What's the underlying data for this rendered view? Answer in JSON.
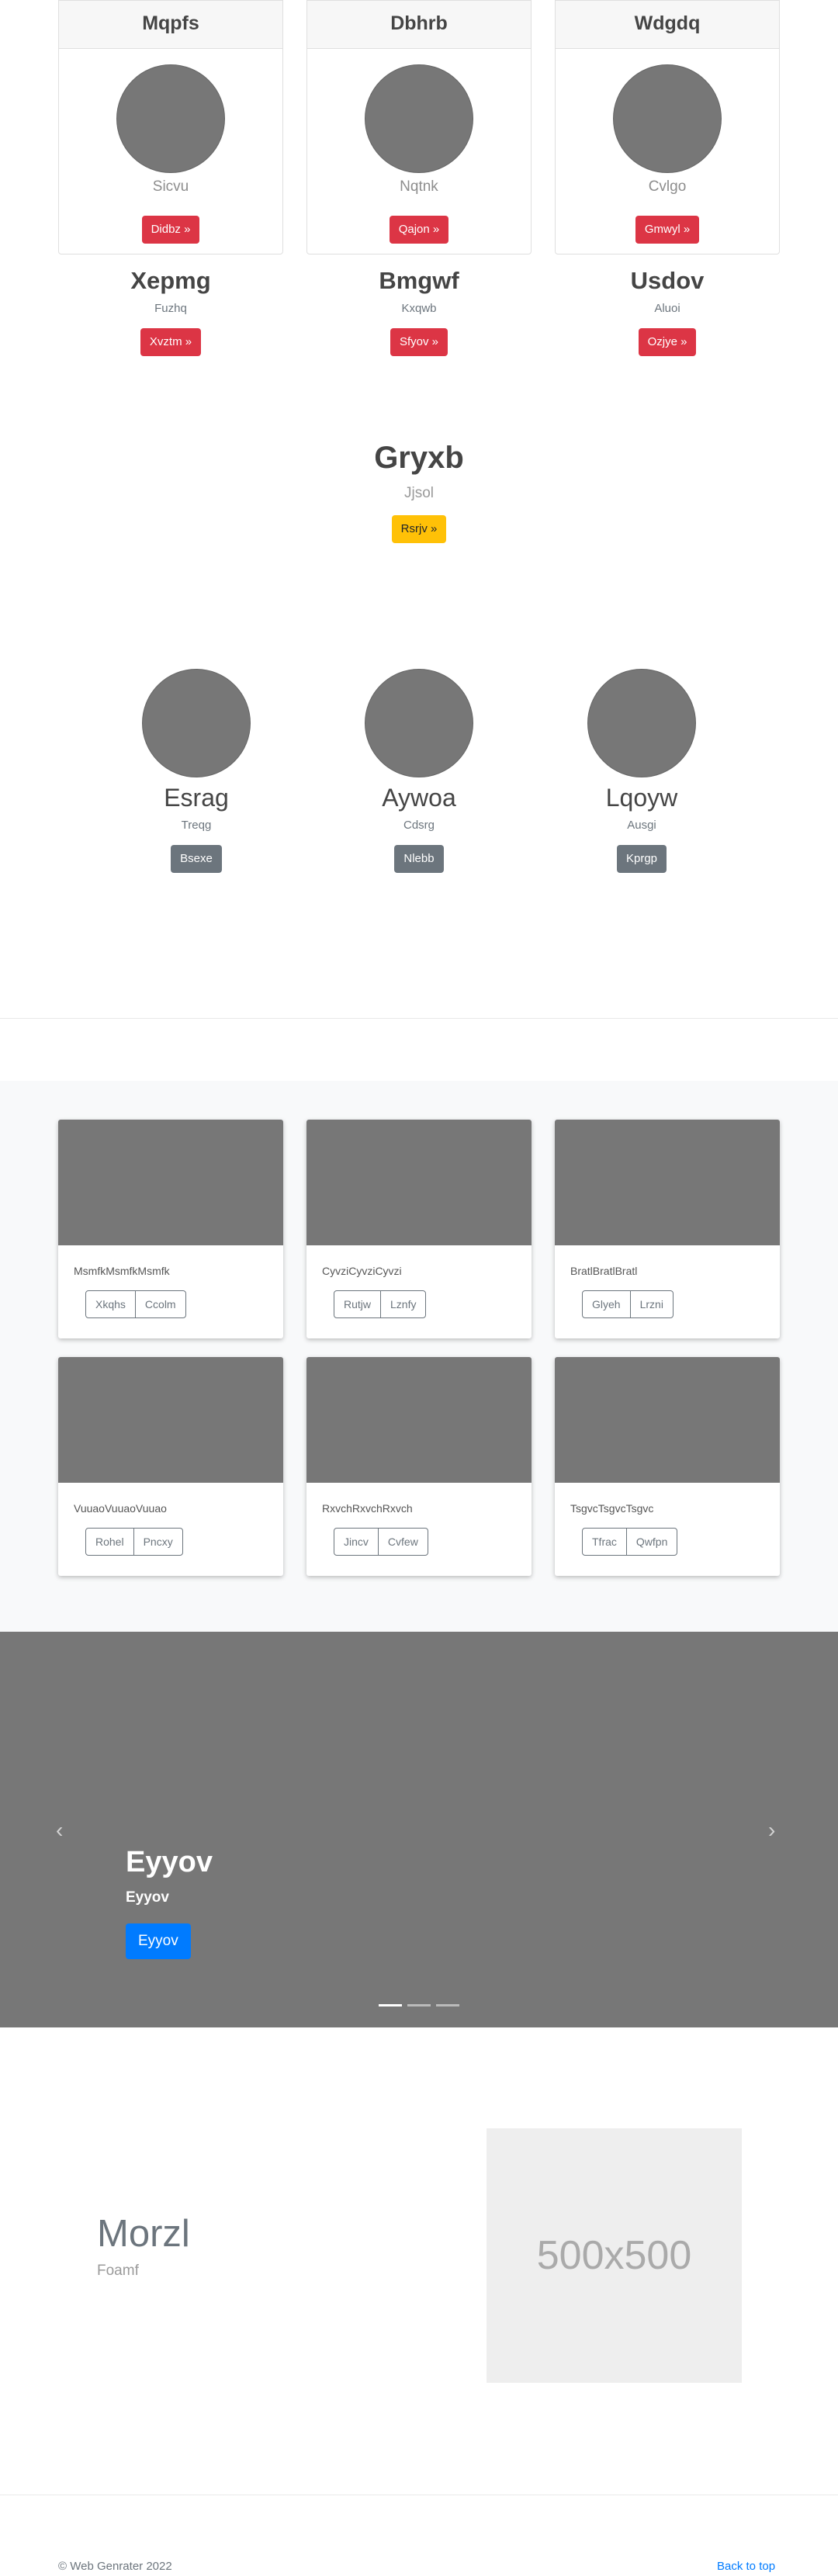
{
  "header_cards": [
    {
      "title": "Mqpfs",
      "subtitle": "Sicvu",
      "button": "Didbz »"
    },
    {
      "title": "Dbhrb",
      "subtitle": "Nqtnk",
      "button": "Qajon »"
    },
    {
      "title": "Wdgdq",
      "subtitle": "Cvlgo",
      "button": "Gmwyl »"
    }
  ],
  "headings": [
    {
      "title": "Xepmg",
      "subtitle": "Fuzhq",
      "button": "Xvztm »"
    },
    {
      "title": "Bmgwf",
      "subtitle": "Kxqwb",
      "button": "Sfyov »"
    },
    {
      "title": "Usdov",
      "subtitle": "Aluoi",
      "button": "Ozjye »"
    }
  ],
  "feature": {
    "title": "Gryxb",
    "subtitle": "Jjsol",
    "button": "Rsrjv »"
  },
  "profiles": [
    {
      "name": "Esrag",
      "subtitle": "Treqg",
      "button": "Bsexe"
    },
    {
      "name": "Aywoa",
      "subtitle": "Cdsrg",
      "button": "Nlebb"
    },
    {
      "name": "Lqoyw",
      "subtitle": "Ausgi",
      "button": "Kprgp"
    }
  ],
  "album": [
    {
      "caption": "MsmfkMsmfkMsmfk",
      "btn1": "Xkqhs",
      "btn2": "Ccolm"
    },
    {
      "caption": "CyvziCyvziCyvzi",
      "btn1": "Rutjw",
      "btn2": "Lznfy"
    },
    {
      "caption": "BratlBratlBratl",
      "btn1": "Glyeh",
      "btn2": "Lrzni"
    },
    {
      "caption": "VuuaoVuuaoVuuao",
      "btn1": "Rohel",
      "btn2": "Pncxy"
    },
    {
      "caption": "RxvchRxvchRxvch",
      "btn1": "Jincv",
      "btn2": "Cvfew"
    },
    {
      "caption": "TsgvcTsgvcTsgvc",
      "btn1": "Tfrac",
      "btn2": "Qwfpn"
    }
  ],
  "carousel": {
    "title": "Eyyov",
    "subtitle": "Eyyov",
    "button": "Eyyov",
    "prev_icon": "‹",
    "next_icon": "›",
    "active_slide": 1,
    "slide_count": 3
  },
  "featurette": {
    "title": "Morzl",
    "subtitle": "Foamf",
    "image_placeholder": "500x500"
  },
  "footer": {
    "copyright": "© Web Genrater 2022",
    "back_to_top": "Back to top"
  },
  "colors": {
    "danger": "#dc3545",
    "warning": "#ffc107",
    "secondary": "#6c757d",
    "primary": "#007bff",
    "placeholder_gray": "#777777"
  }
}
